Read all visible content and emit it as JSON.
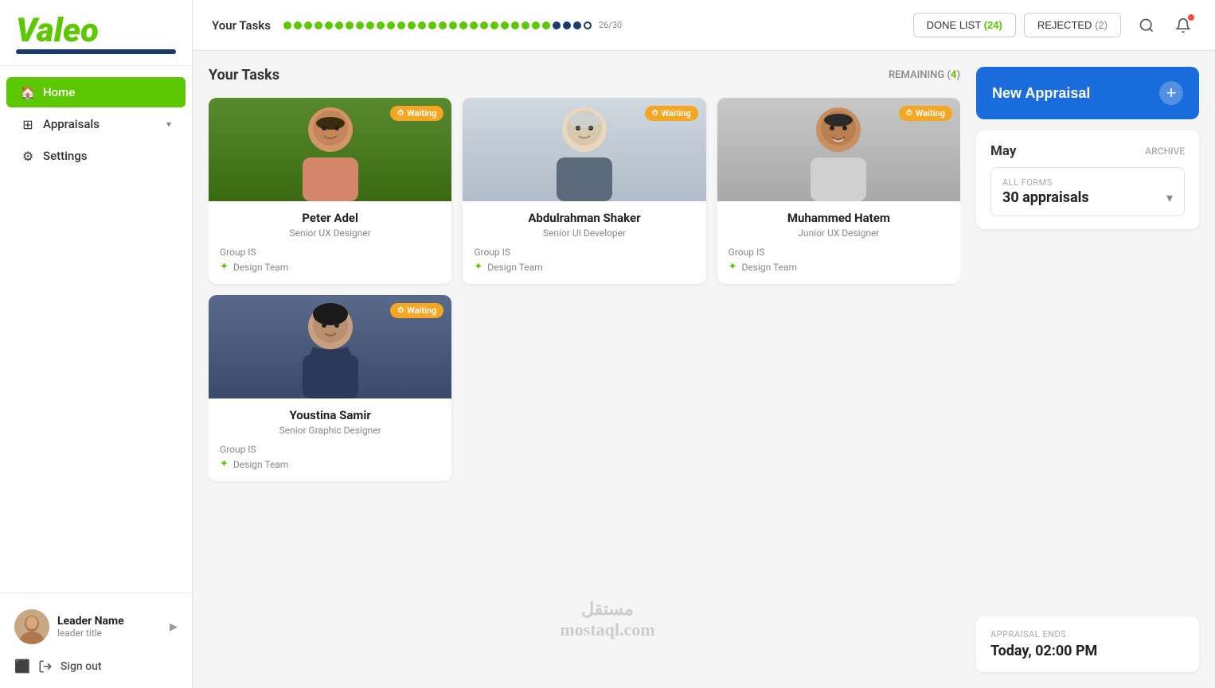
{
  "sidebar": {
    "logo": "Valeo",
    "nav_items": [
      {
        "id": "home",
        "label": "Home",
        "icon": "🏠",
        "active": true
      },
      {
        "id": "appraisals",
        "label": "Appraisals",
        "icon": "⊞",
        "active": false,
        "has_arrow": true
      },
      {
        "id": "settings",
        "label": "Settings",
        "icon": "⚙",
        "active": false
      }
    ],
    "user": {
      "name": "Leader Name",
      "title": "leader title"
    },
    "sign_out_label": "Sign out"
  },
  "topbar": {
    "title": "Your Tasks",
    "progress": "26/30",
    "done_list_label": "DONE LIST",
    "done_list_count": "24",
    "rejected_label": "REJECTED",
    "rejected_count": "2"
  },
  "tasks": {
    "section_title": "Your Tasks",
    "remaining_label": "REMAINING",
    "remaining_count": "4",
    "cards": [
      {
        "id": "peter",
        "name": "Peter Adel",
        "role": "Senior UX Designer",
        "group": "Group IS",
        "team": "Design Team",
        "status": "Waiting"
      },
      {
        "id": "abdulrahman",
        "name": "Abdulrahman Shaker",
        "role": "Senior UI Developer",
        "group": "Group IS",
        "team": "Design Team",
        "status": "Waiting"
      },
      {
        "id": "muhammed",
        "name": "Muhammed Hatem",
        "role": "Junior UX Designer",
        "group": "Group IS",
        "team": "Design Team",
        "status": "Waiting"
      },
      {
        "id": "youstina",
        "name": "Youstina Samir",
        "role": "Senior Graphic Designer",
        "group": "Group IS",
        "team": "Design Team",
        "status": "Waiting"
      }
    ]
  },
  "right_panel": {
    "new_appraisal_label": "New Appraisal",
    "month_label": "May",
    "archive_label": "ARCHIVE",
    "all_forms_label": "ALL FORMS",
    "appraisals_count_label": "30 appraisals",
    "appraisal_ends_label": "APPRAISAL ENDS",
    "appraisal_ends_value": "Today, 02:00 PM"
  },
  "watermark": {
    "arabic": "مستقل",
    "english": "mostaql.com"
  }
}
